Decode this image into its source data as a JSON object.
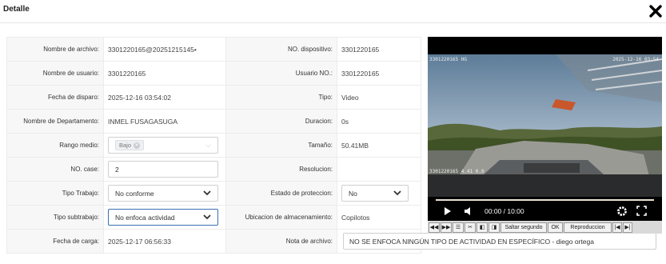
{
  "dialog": {
    "title": "Detalle",
    "close_icon": "close-icon"
  },
  "form": {
    "rows": [
      {
        "left_label": "Nombre de archivo:",
        "left_value": "3301220165@20251215145•",
        "right_label": "NO. dispositivo:",
        "right_value": "3301220165"
      },
      {
        "left_label": "Nombre de usuario:",
        "left_value": "3301220165",
        "right_label": "Usuario NO.:",
        "right_value": "3301220165"
      },
      {
        "left_label": "Fecha de disparo:",
        "left_value": "2025-12-16 03:54:02",
        "right_label": "Tipo:",
        "right_value": "Video"
      },
      {
        "left_label": "Nombre de Departamento:",
        "left_value": "INMEL FUSAGASUGA",
        "right_label": "Duracion:",
        "right_value": "0s"
      },
      {
        "left_label": "Rango medio:",
        "left_value": "Bajo",
        "right_label": "Tamaño:",
        "right_value": "50.41MB"
      },
      {
        "left_label": "NO. case:",
        "left_value": "2",
        "right_label": "Resolucion:",
        "right_value": ""
      },
      {
        "left_label": "Tipo Trabajo:",
        "left_value": "No conforme",
        "right_label": "Estado de proteccion:",
        "right_value": "No"
      },
      {
        "left_label": "Tipo subtrabajo:",
        "left_value": "No enfoca actividad",
        "right_label": "Ubicacion de almacenamiento:",
        "right_value": "Copilotos"
      },
      {
        "left_label": "Fecha de carga:",
        "left_value": "2025-12-17 06:56:33",
        "right_label": "Nota de archivo:",
        "right_value": "NO SE ENFOCA NINGÚN TIPO DE ACTIVIDAD EN ESPECÍFICO - diego ortega"
      }
    ]
  },
  "player": {
    "time": "00:00 / 10:00",
    "progress_fraction": 0.0,
    "overlay_left": "3301220165 HG",
    "overlay_right": "2025-12-16 03:54",
    "overlay_bottom": "3301220165 4.41 0.0",
    "icons": [
      "play-icon",
      "volume-icon",
      "settings-icon",
      "fullscreen-icon"
    ]
  },
  "toolbar": {
    "skip_label": "Saltar segundo",
    "ok_label": "OK",
    "playback_label": "Reproduccion",
    "icons": [
      "rewind-icon",
      "fast-forward-icon",
      "list-icon",
      "cut-icon",
      "frame-back-icon",
      "frame-forward-icon",
      "prev-icon",
      "next-icon"
    ]
  }
}
